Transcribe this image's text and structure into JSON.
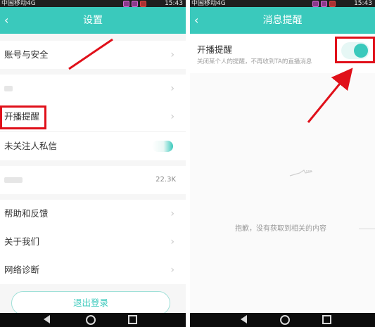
{
  "left": {
    "status": {
      "carrier": "中国移动4G",
      "time": "15:43"
    },
    "title": "设置",
    "back_icon": "‹",
    "rows": {
      "account": "账号与安全",
      "faint_row_value": "",
      "live_reminder": "开播提醒",
      "unfollowed_dm": "未关注人私信",
      "cache_value": "22.3K",
      "help": "帮助和反馈",
      "about": "关于我们",
      "network": "网络诊断"
    },
    "logout": "退出登录"
  },
  "right": {
    "status": {
      "carrier": "中国移动4G",
      "time": "15:43"
    },
    "title": "消息提醒",
    "back_icon": "‹",
    "live_reminder": {
      "title": "开播提醒",
      "desc": "关闭某个人的提醒，不再收到TA的直播消息",
      "toggle_state": "on"
    },
    "empty_text": "抱歉，没有获取到相关的内容"
  },
  "colors": {
    "accent": "#3ac9bc",
    "annotation": "#e0101a"
  },
  "icons": [
    "chevron-right-icon",
    "back-icon",
    "toggle-icon",
    "nav-back-icon",
    "nav-home-icon",
    "nav-recent-icon",
    "empty-state-icon"
  ]
}
